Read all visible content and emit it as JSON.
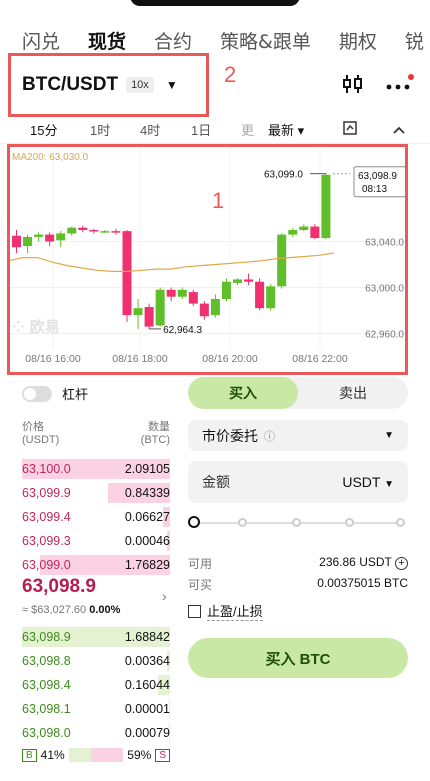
{
  "topnav": {
    "tabs": [
      "闪兑",
      "现货",
      "合约",
      "策略&跟单",
      "期权",
      "锐"
    ]
  },
  "pair": {
    "name": "BTC/USDT",
    "leverage": "10x"
  },
  "annotations": {
    "box1": "1",
    "box2": "2"
  },
  "chart_controls": {
    "timeframes": [
      "15分",
      "1时",
      "4时",
      "1日",
      "更"
    ],
    "latest": "最新"
  },
  "chart_data": {
    "type": "candlestick",
    "ma_label": "MA200: 63,030.0",
    "high_label": "63,099.0",
    "low_label": "62,964.3",
    "last_price": "63,098.9",
    "countdown": "08:13",
    "y_ticks": [
      "63,040.0",
      "63,000.0",
      "62,960.0"
    ],
    "x_ticks": [
      "08/16 16:00",
      "08/16 18:00",
      "08/16 20:00",
      "08/16 22:00"
    ],
    "candles": [
      {
        "o": 63045,
        "c": 63035,
        "h": 63050,
        "l": 63030
      },
      {
        "o": 63036,
        "c": 63044,
        "h": 63046,
        "l": 63030
      },
      {
        "o": 63044,
        "c": 63046,
        "h": 63048,
        "l": 63040
      },
      {
        "o": 63046,
        "c": 63040,
        "h": 63048,
        "l": 63036
      },
      {
        "o": 63041,
        "c": 63047,
        "h": 63049,
        "l": 63035
      },
      {
        "o": 63047,
        "c": 63052,
        "h": 63053,
        "l": 63045
      },
      {
        "o": 63052,
        "c": 63050,
        "h": 63054,
        "l": 63048
      },
      {
        "o": 63050,
        "c": 63049,
        "h": 63051,
        "l": 63047
      },
      {
        "o": 63049,
        "c": 63049,
        "h": 63050,
        "l": 63048
      },
      {
        "o": 63049,
        "c": 63048,
        "h": 63051,
        "l": 63046
      },
      {
        "o": 63049,
        "c": 62976,
        "h": 63050,
        "l": 62970
      },
      {
        "o": 62976,
        "c": 62982,
        "h": 62990,
        "l": 62964
      },
      {
        "o": 62983,
        "c": 62966,
        "h": 62986,
        "l": 62964
      },
      {
        "o": 62967,
        "c": 62998,
        "h": 63000,
        "l": 62966
      },
      {
        "o": 62998,
        "c": 62992,
        "h": 63000,
        "l": 62988
      },
      {
        "o": 62992,
        "c": 62998,
        "h": 63000,
        "l": 62990
      },
      {
        "o": 62996,
        "c": 62986,
        "h": 62998,
        "l": 62984
      },
      {
        "o": 62986,
        "c": 62975,
        "h": 62988,
        "l": 62972
      },
      {
        "o": 62976,
        "c": 62990,
        "h": 62994,
        "l": 62974
      },
      {
        "o": 62990,
        "c": 63005,
        "h": 63008,
        "l": 62988
      },
      {
        "o": 63004,
        "c": 63007,
        "h": 63008,
        "l": 63002
      },
      {
        "o": 63007,
        "c": 63005,
        "h": 63012,
        "l": 63002
      },
      {
        "o": 63005,
        "c": 62982,
        "h": 63008,
        "l": 62980
      },
      {
        "o": 62982,
        "c": 63001,
        "h": 63003,
        "l": 62980
      },
      {
        "o": 63001,
        "c": 63046,
        "h": 63047,
        "l": 62999
      },
      {
        "o": 63046,
        "c": 63050,
        "h": 63052,
        "l": 63044
      },
      {
        "o": 63050,
        "c": 63053,
        "h": 63055,
        "l": 63049
      },
      {
        "o": 63053,
        "c": 63043,
        "h": 63055,
        "l": 63042
      },
      {
        "o": 63043,
        "c": 63098,
        "h": 63099,
        "l": 63042
      }
    ],
    "ma": [
      63023,
      63026,
      63026,
      63022,
      63019,
      63017,
      63015,
      63014,
      63014,
      63015,
      63016,
      63016,
      63018,
      63019,
      63020,
      63021,
      63022,
      63023,
      63025,
      63026,
      63027,
      63028,
      63030
    ]
  },
  "orderform": {
    "leverage_toggle": "杠杆",
    "buy_tab": "买入",
    "sell_tab": "卖出",
    "order_type": "市价委托",
    "amount_label": "金额",
    "amount_unit": "USDT",
    "available_label": "可用",
    "available_value": "236.86 USDT",
    "buyable_label": "可买",
    "buyable_value": "0.00375015 BTC",
    "tp_sl_label": "止盈/止损",
    "buy_button": "买入 BTC"
  },
  "orderbook": {
    "price_header": "价格\n(USDT)",
    "qty_header": "数量\n(BTC)",
    "asks": [
      {
        "price": "63,100.0",
        "qty": "2.09105",
        "depth": 1.0
      },
      {
        "price": "63,099.9",
        "qty": "0.84339",
        "depth": 0.42
      },
      {
        "price": "63,099.4",
        "qty": "0.06627",
        "depth": 0.05
      },
      {
        "price": "63,099.3",
        "qty": "0.00046",
        "depth": 0.02
      },
      {
        "price": "63,099.0",
        "qty": "1.76829",
        "depth": 0.88
      }
    ],
    "mid_price": "63,098.9",
    "mid_usd": "≈ $63,027.60",
    "mid_change": "0.00%",
    "bids": [
      {
        "price": "63,098.9",
        "qty": "1.68842",
        "depth": 1.0
      },
      {
        "price": "63,098.8",
        "qty": "0.00364",
        "depth": 0.02
      },
      {
        "price": "63,098.4",
        "qty": "0.16044",
        "depth": 0.08
      },
      {
        "price": "63,098.1",
        "qty": "0.00001",
        "depth": 0.01
      },
      {
        "price": "63,098.0",
        "qty": "0.00079",
        "depth": 0.01
      }
    ],
    "buy_ratio": "41%",
    "sell_ratio": "59%",
    "b_label": "B",
    "s_label": "S"
  }
}
